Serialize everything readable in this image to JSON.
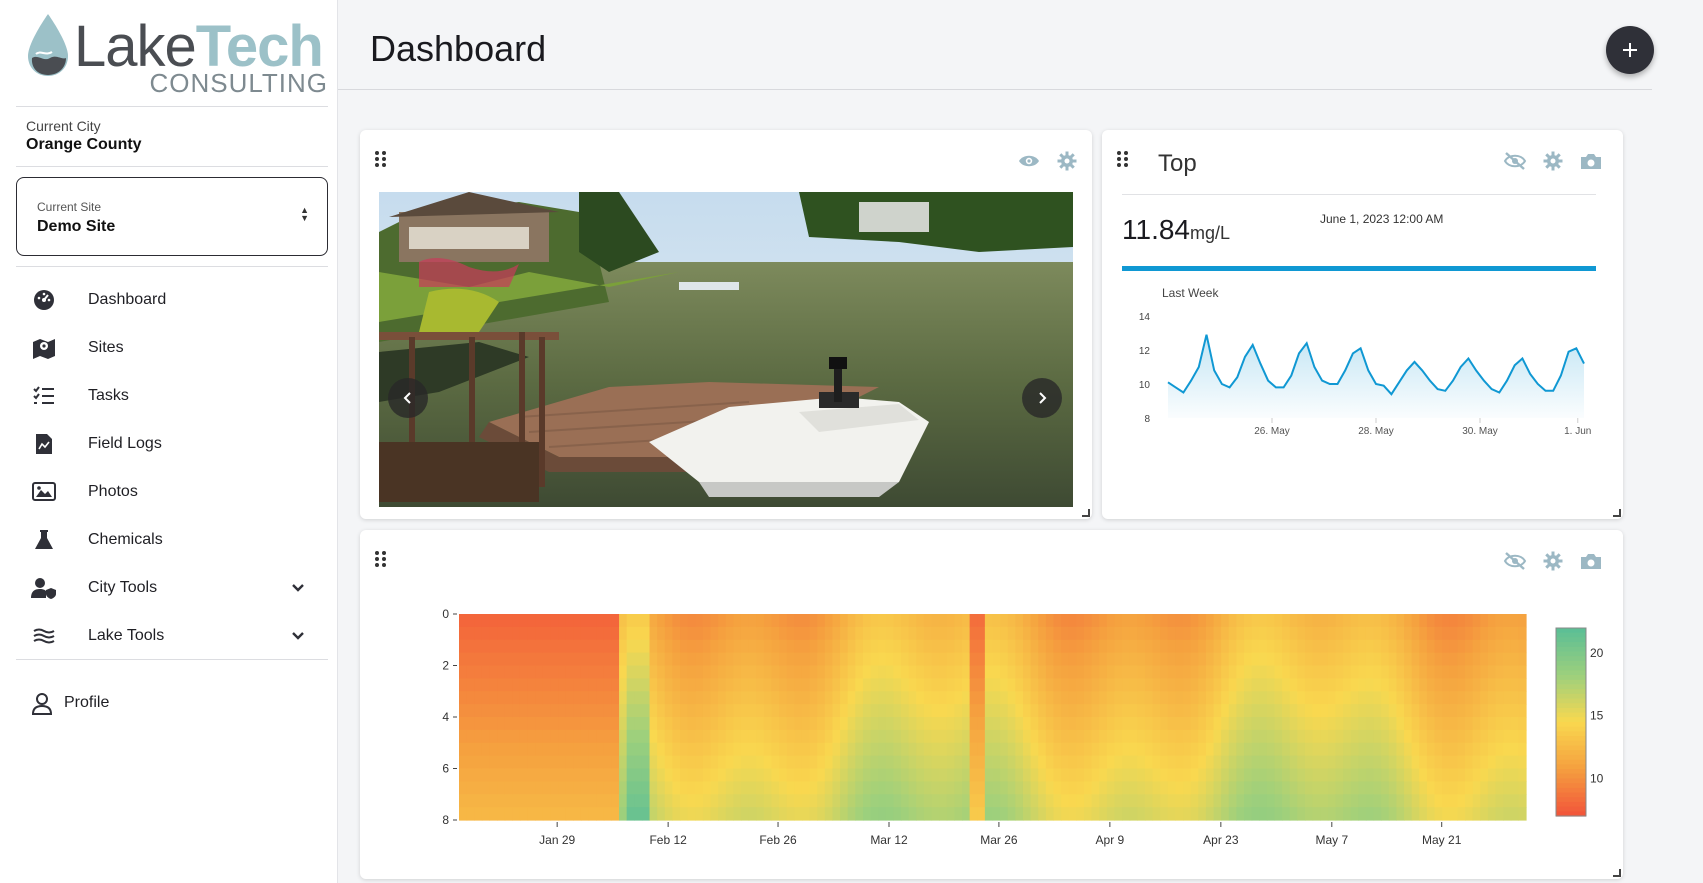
{
  "brand": {
    "name_part1": "Lake",
    "name_part2": "Tech",
    "subtitle": "CONSULTING"
  },
  "sidebar": {
    "city_label": "Current City",
    "city_value": "Orange County",
    "site_label": "Current Site",
    "site_value": "Demo Site",
    "items": [
      {
        "label": "Dashboard",
        "icon": "gauge-icon"
      },
      {
        "label": "Sites",
        "icon": "map-marker-icon"
      },
      {
        "label": "Tasks",
        "icon": "checklist-icon"
      },
      {
        "label": "Field Logs",
        "icon": "file-chart-icon"
      },
      {
        "label": "Photos",
        "icon": "images-icon"
      },
      {
        "label": "Chemicals",
        "icon": "flask-icon"
      },
      {
        "label": "City Tools",
        "icon": "user-shield-icon",
        "expandable": true
      },
      {
        "label": "Lake Tools",
        "icon": "water-waves-icon",
        "expandable": true
      }
    ],
    "profile_label": "Profile"
  },
  "header": {
    "title": "Dashboard"
  },
  "cards": {
    "top": {
      "title": "Top",
      "value": "11.84",
      "unit": "mg/L",
      "timestamp": "June 1, 2023 12:00 AM",
      "range_label": "Last Week"
    }
  },
  "chart_data": [
    {
      "type": "line",
      "title": "",
      "subtitle": "Last Week",
      "y_ticks": [
        8,
        10,
        12,
        14
      ],
      "ylim": [
        8,
        14
      ],
      "x_ticks": [
        "26. May",
        "28. May",
        "30. May",
        "1. Jun"
      ],
      "series": [
        {
          "values": [
            10.1,
            9.8,
            9.5,
            10.2,
            11.0,
            12.9,
            10.8,
            10.0,
            9.8,
            10.4,
            11.6,
            12.3,
            11.2,
            10.2,
            9.8,
            9.8,
            10.5,
            11.8,
            12.4,
            11.0,
            10.2,
            10.0,
            10.0,
            10.8,
            11.8,
            12.1,
            10.8,
            10.0,
            9.9,
            9.4,
            10.1,
            10.8,
            11.3,
            10.8,
            10.2,
            9.7,
            9.6,
            10.2,
            11.0,
            11.5,
            10.8,
            10.2,
            9.7,
            9.5,
            10.2,
            11.1,
            11.5,
            10.6,
            10.0,
            9.6,
            9.6,
            10.5,
            11.9,
            12.1,
            11.2
          ]
        }
      ],
      "color": "#1098d3"
    },
    {
      "type": "heatmap",
      "x_ticks": [
        "Jan 29",
        "Feb 12",
        "Feb 26",
        "Mar 12",
        "Mar 26",
        "Apr 9",
        "Apr 23",
        "May 7",
        "May 21"
      ],
      "y_ticks": [
        0,
        2,
        4,
        6,
        8
      ],
      "ylim": [
        0,
        8
      ],
      "colorbar_ticks": [
        10,
        15,
        20
      ],
      "colorscale": [
        "#f2573a",
        "#f5a13f",
        "#f9d84f",
        "#9ed07c",
        "#5dbf95"
      ]
    }
  ]
}
